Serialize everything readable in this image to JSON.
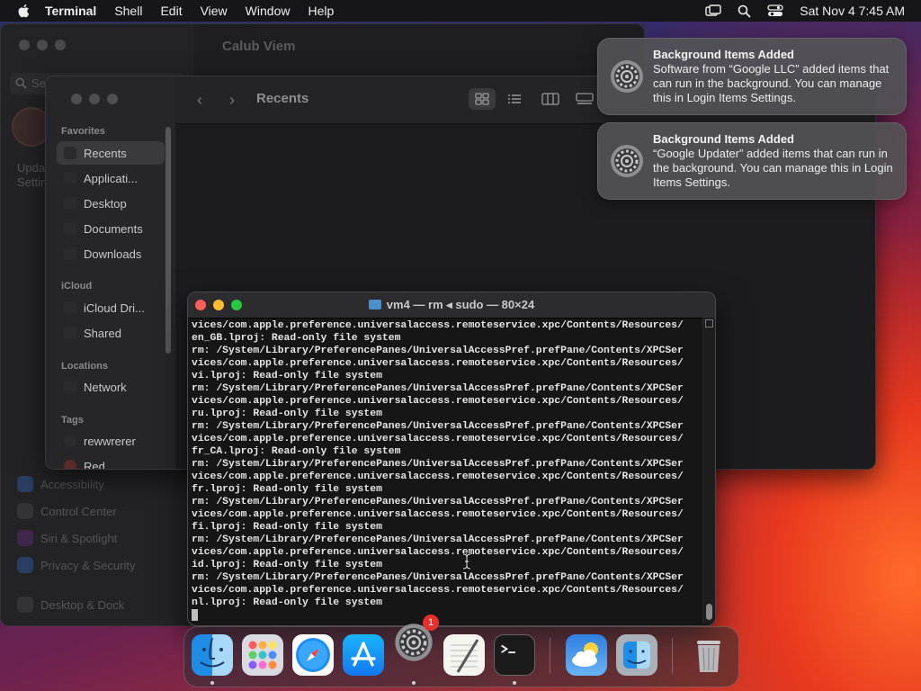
{
  "menubar": {
    "app_name": "Terminal",
    "items": [
      "Shell",
      "Edit",
      "View",
      "Window",
      "Help"
    ],
    "datetime": "Sat Nov 4  7:45 AM"
  },
  "settings_window": {
    "title": "Calub Viem",
    "search_placeholder": "Search",
    "sidebar_items": [
      "Updates",
      "Settings",
      "Accessibility",
      "Control Center",
      "Siri & Spotlight",
      "Privacy & Security",
      "Desktop & Dock"
    ]
  },
  "finder": {
    "title": "Recents",
    "favorites_header": "Favorites",
    "favorites": [
      "Recents",
      "Applicati...",
      "Desktop",
      "Documents",
      "Downloads"
    ],
    "icloud_header": "iCloud",
    "icloud": [
      "iCloud Dri...",
      "Shared"
    ],
    "locations_header": "Locations",
    "locations": [
      "Network"
    ],
    "tags_header": "Tags",
    "tags": [
      "rewwrerer",
      "Red"
    ]
  },
  "notifications": [
    {
      "title": "Background Items Added",
      "body": "Software from “Google LLC” added items that can run in the background. You can manage this in Login Items Settings."
    },
    {
      "title": "Background Items Added",
      "body": "“Google Updater” added items that can run in the background. You can manage this in Login Items Settings."
    }
  ],
  "terminal": {
    "title": "vm4 — rm ◂ sudo — 80×24",
    "lines": [
      "vices/com.apple.preference.universalaccess.remoteservice.xpc/Contents/Resources/",
      "en_GB.lproj: Read-only file system",
      "rm: /System/Library/PreferencePanes/UniversalAccessPref.prefPane/Contents/XPCSer",
      "vices/com.apple.preference.universalaccess.remoteservice.xpc/Contents/Resources/",
      "vi.lproj: Read-only file system",
      "rm: /System/Library/PreferencePanes/UniversalAccessPref.prefPane/Contents/XPCSer",
      "vices/com.apple.preference.universalaccess.remoteservice.xpc/Contents/Resources/",
      "ru.lproj: Read-only file system",
      "rm: /System/Library/PreferencePanes/UniversalAccessPref.prefPane/Contents/XPCSer",
      "vices/com.apple.preference.universalaccess.remoteservice.xpc/Contents/Resources/",
      "fr_CA.lproj: Read-only file system",
      "rm: /System/Library/PreferencePanes/UniversalAccessPref.prefPane/Contents/XPCSer",
      "vices/com.apple.preference.universalaccess.remoteservice.xpc/Contents/Resources/",
      "fr.lproj: Read-only file system",
      "rm: /System/Library/PreferencePanes/UniversalAccessPref.prefPane/Contents/XPCSer",
      "vices/com.apple.preference.universalaccess.remoteservice.xpc/Contents/Resources/",
      "fi.lproj: Read-only file system",
      "rm: /System/Library/PreferencePanes/UniversalAccessPref.prefPane/Contents/XPCSer",
      "vices/com.apple.preference.universalaccess.remoteservice.xpc/Contents/Resources/",
      "id.lproj: Read-only file system",
      "rm: /System/Library/PreferencePanes/UniversalAccessPref.prefPane/Contents/XPCSer",
      "vices/com.apple.preference.universalaccess.remoteservice.xpc/Contents/Resources/",
      "nl.lproj: Read-only file system"
    ]
  },
  "dock": {
    "apps": [
      "finder-icon",
      "launchpad-icon",
      "safari-icon",
      "app-store-icon",
      "system-settings-icon",
      "textedit-icon",
      "terminal-icon",
      "weather-icon",
      "migration-assistant-icon",
      "trash-icon"
    ],
    "settings_badge": "1"
  }
}
